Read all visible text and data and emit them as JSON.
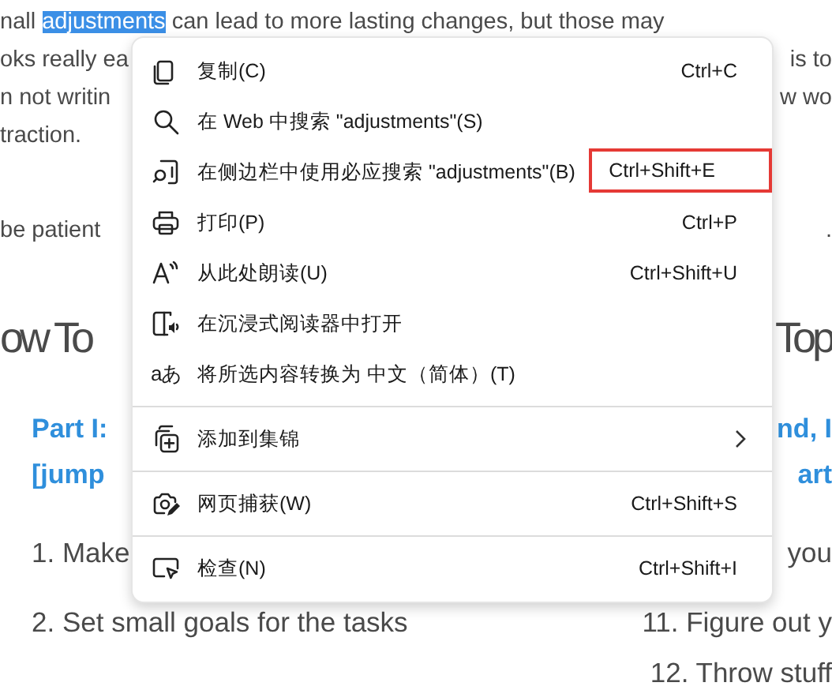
{
  "article": {
    "lines": [
      {
        "kind": "para",
        "left": "nall ",
        "selected": "adjustments",
        "rest": " can lead to more lasting changes, but those may"
      },
      {
        "kind": "para",
        "left": "oks really ea",
        "right": "is to"
      },
      {
        "kind": "para",
        "left": "n not writin",
        "right": "w wo"
      },
      {
        "kind": "para",
        "left": "traction."
      },
      {
        "kind": "para_break",
        "left": "be patient",
        "right": "."
      },
      {
        "kind": "heading",
        "left": "ow To",
        "right": "Top"
      },
      {
        "kind": "sub",
        "left": "Part I:",
        "right": "nd, I"
      },
      {
        "kind": "sub",
        "left": "[jump",
        "right": "art"
      },
      {
        "kind": "list",
        "left": "1. Make",
        "right": "you"
      },
      {
        "kind": "list",
        "left": "2. Set small goals for the tasks",
        "right": "11. Figure out y"
      },
      {
        "kind": "list_tight",
        "right": "12. Throw stuff"
      }
    ]
  },
  "menu": {
    "items": [
      {
        "label": "复制(C)",
        "shortcut": "Ctrl+C",
        "highlighted": false,
        "submenu": false,
        "divider_before": false
      },
      {
        "label": "在 Web 中搜索 \"adjustments\"(S)",
        "highlighted": false,
        "submenu": false,
        "divider_before": false
      },
      {
        "label": "在侧边栏中使用必应搜索 \"adjustments\"(B)",
        "shortcut": "Ctrl+Shift+E",
        "highlighted": true,
        "submenu": false,
        "divider_before": false
      },
      {
        "label": "打印(P)",
        "shortcut": "Ctrl+P",
        "highlighted": false,
        "submenu": false,
        "divider_before": false
      },
      {
        "label": "从此处朗读(U)",
        "shortcut": "Ctrl+Shift+U",
        "highlighted": false,
        "submenu": false,
        "divider_before": false
      },
      {
        "label": "在沉浸式阅读器中打开",
        "highlighted": false,
        "submenu": false,
        "divider_before": false
      },
      {
        "label": "将所选内容转换为 中文（简体）(T)",
        "icon_text": "aあ",
        "highlighted": false,
        "submenu": false,
        "divider_before": false
      },
      {
        "label": "添加到集锦",
        "highlighted": false,
        "submenu": true,
        "divider_before": true
      },
      {
        "label": "网页捕获(W)",
        "shortcut": "Ctrl+Shift+S",
        "highlighted": false,
        "submenu": false,
        "divider_before": true
      },
      {
        "label": "检查(N)",
        "shortcut": "Ctrl+Shift+I",
        "highlighted": false,
        "submenu": false,
        "divider_before": true
      }
    ]
  }
}
